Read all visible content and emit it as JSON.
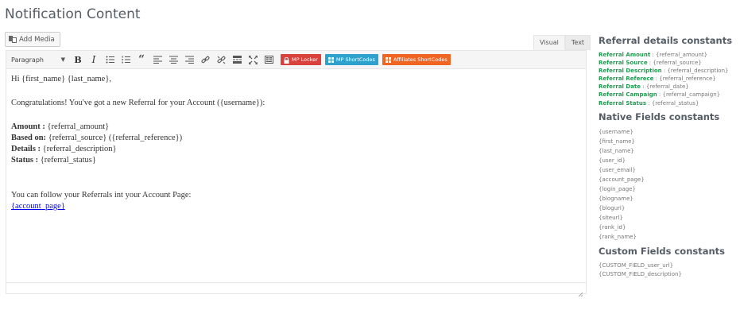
{
  "page": {
    "title": "Notification Content"
  },
  "editor": {
    "add_media_label": "Add Media",
    "tabs": [
      {
        "label": "Visual",
        "active": true
      },
      {
        "label": "Text",
        "active": false
      }
    ],
    "toolbar": {
      "format_value": "Paragraph",
      "icons": [
        "bold-icon",
        "italic-icon",
        "bullet-list-icon",
        "numbered-list-icon",
        "blockquote-icon",
        "align-left-icon",
        "align-center-icon",
        "align-right-icon",
        "link-icon",
        "unlink-icon",
        "read-more-icon",
        "fullscreen-icon",
        "toolbar-toggle-icon"
      ],
      "buttons": [
        {
          "label": "MP Locker",
          "color": "#d9413d",
          "icon": "lock-icon"
        },
        {
          "label": "MP ShortCodes",
          "color": "#2ea2cc",
          "icon": "grid-icon"
        },
        {
          "label": "Affiliates ShortCodes",
          "color": "#f16522",
          "icon": "grid-icon"
        }
      ]
    },
    "content": {
      "greeting": "Hi {first_name} {last_name},",
      "intro": "Congratulations! You've got a new Referral for your Account ({username}):",
      "amount_label": "Amount :",
      "amount_value": " {referral_amount}",
      "based_label": "Based on:",
      "based_value": " {referral_source} ({referral_reference})",
      "details_label": "Details :",
      "details_value": " {referral_description}",
      "status_label": "Status :",
      "status_value": " {referral_status}",
      "follow": "You can follow your Referrals int your Account Page:",
      "account_link": "{account_page}"
    }
  },
  "sidebar": {
    "referral": {
      "heading": "Referral details constants",
      "items": [
        {
          "key": "Referral Amount",
          "value": " : {referral_amount}"
        },
        {
          "key": "Referral Source",
          "value": " : {referral_source}"
        },
        {
          "key": "Referral Description",
          "value": " : {referral_description}"
        },
        {
          "key": "Referral Referece",
          "value": " : {referral_reference}"
        },
        {
          "key": "Referral Date",
          "value": " : {referral_date}"
        },
        {
          "key": "Referral Campaign",
          "value": " : {referral_campaign}"
        },
        {
          "key": "Referral Status",
          "value": " : {referral_status}"
        }
      ]
    },
    "native": {
      "heading": "Native Fields constants",
      "items": [
        "{username}",
        "{first_name}",
        "{last_name}",
        "{user_id}",
        "{user_email}",
        "{account_page}",
        "{login_page}",
        "{blogname}",
        "{blogurl}",
        "{siteurl}",
        "{rank_id}",
        "{rank_name}"
      ]
    },
    "custom": {
      "heading": "Custom Fields constants",
      "items": [
        "{CUSTOM_FIELD_user_url}",
        "{CUSTOM_FIELD_description}"
      ]
    }
  },
  "colors": {
    "accent_green": "#1c9d4e",
    "heading_gray": "#555d66"
  }
}
